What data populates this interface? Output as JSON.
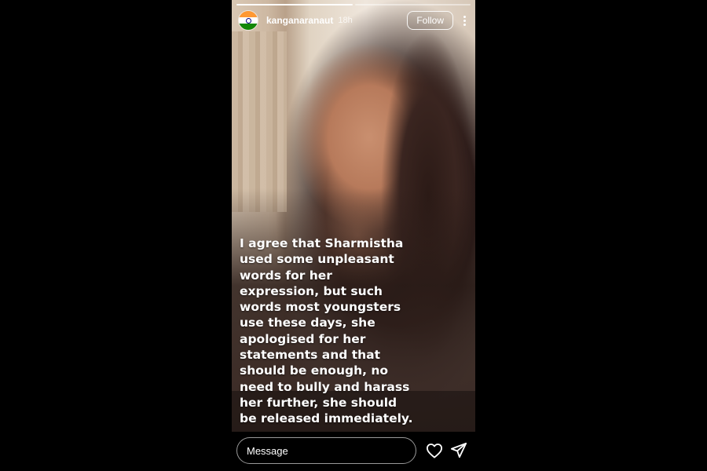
{
  "story": {
    "progress": {
      "segments": 2,
      "current": 1
    },
    "account": {
      "avatar": "india-flag-avatar",
      "username": "kanganaranaut",
      "time": "18h"
    },
    "follow_label": "Follow",
    "more_icon": "more-vertical-icon",
    "caption": "I agree that Sharmistha\nused some unpleasant\nwords for her\nexpression, but such\nwords most youngsters\nuse these days, she\napologised for her\nstatements and that\nshould be enough, no\nneed to bully and harass\nher further, she should\nbe released immediately.",
    "reply": {
      "placeholder": "Message",
      "like_icon": "heart-icon",
      "share_icon": "send-icon"
    }
  },
  "colors": {
    "background": "#000000",
    "text": "#ffffff",
    "flag_saffron": "#ff9933",
    "flag_white": "#ffffff",
    "flag_green": "#138808"
  }
}
